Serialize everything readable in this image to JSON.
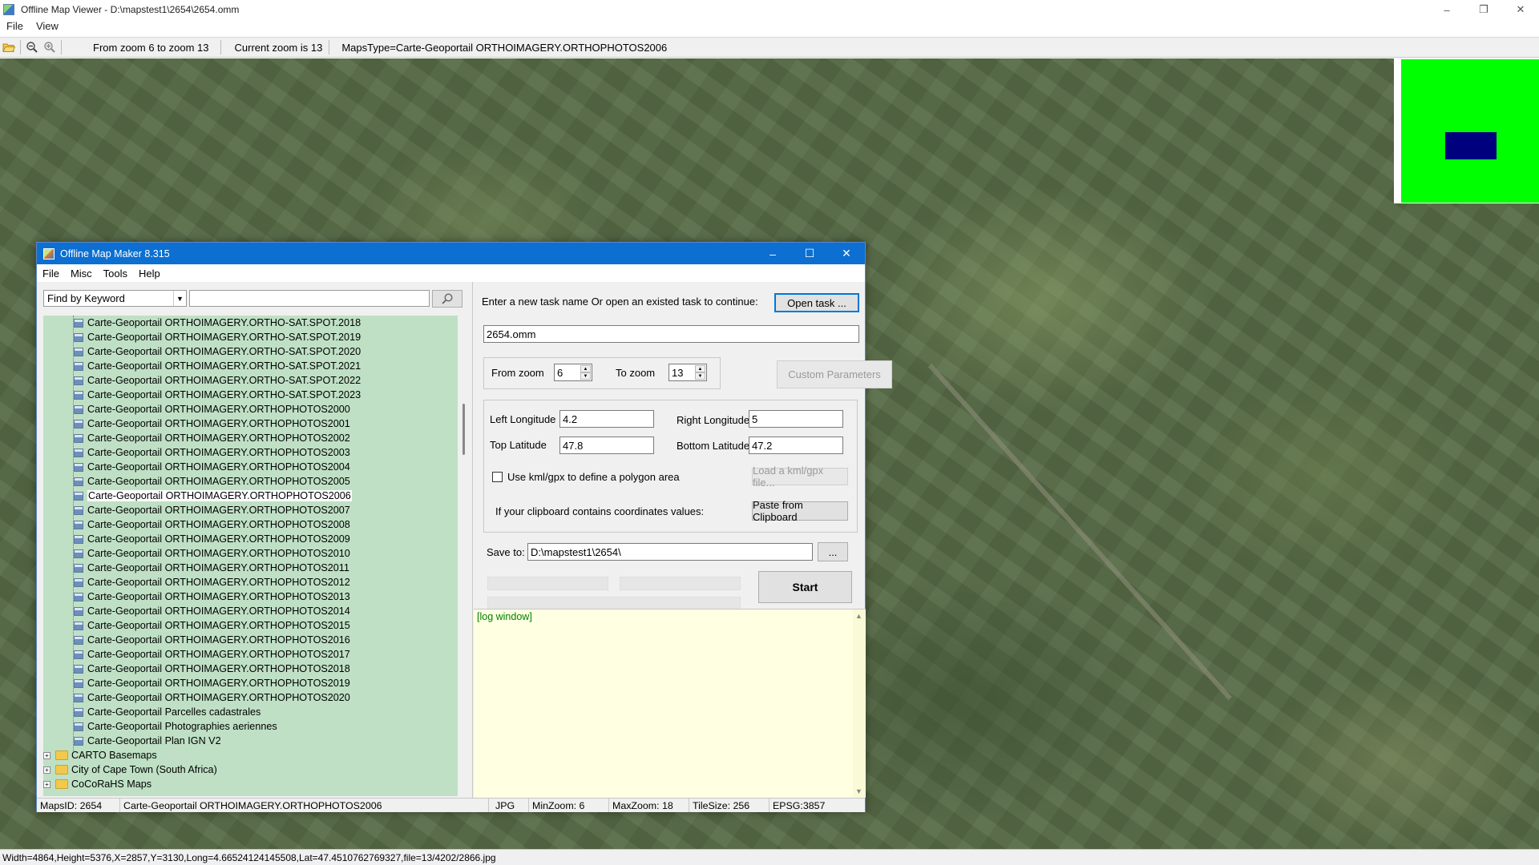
{
  "window": {
    "title": "Offline Map Viewer - D:\\mapstest1\\2654\\2654.omm"
  },
  "menu": [
    "File",
    "View"
  ],
  "toolbar": {
    "zoom_range": "From zoom 6 to zoom 13",
    "current_zoom": "Current zoom is 13",
    "maps_type": "MapsType=Carte-Geoportail ORTHOIMAGERY.ORTHOPHOTOS2006",
    "icons": [
      "folder-open-icon",
      "zoom-out-icon",
      "zoom-in-icon"
    ]
  },
  "overview": {
    "background": "#00ff00",
    "viewport_color": "#00007f"
  },
  "status": "Width=4864,Height=5376,X=2857,Y=3130,Long=4.66524124145508,Lat=47.4510762769327,file=13/4202/2866.jpg",
  "dialog": {
    "title": "Offline Map Maker 8.315",
    "menu": [
      "File",
      "Misc",
      "Tools",
      "Help"
    ],
    "search": {
      "mode": "Find by Keyword",
      "value": "",
      "icon": "search-icon"
    },
    "tree": [
      {
        "label": "Carte-Geoportail ORTHOIMAGERY.ORTHO-SAT.SPOT.2018",
        "type": "leaf"
      },
      {
        "label": "Carte-Geoportail ORTHOIMAGERY.ORTHO-SAT.SPOT.2019",
        "type": "leaf"
      },
      {
        "label": "Carte-Geoportail ORTHOIMAGERY.ORTHO-SAT.SPOT.2020",
        "type": "leaf"
      },
      {
        "label": "Carte-Geoportail ORTHOIMAGERY.ORTHO-SAT.SPOT.2021",
        "type": "leaf"
      },
      {
        "label": "Carte-Geoportail ORTHOIMAGERY.ORTHO-SAT.SPOT.2022",
        "type": "leaf"
      },
      {
        "label": "Carte-Geoportail ORTHOIMAGERY.ORTHO-SAT.SPOT.2023",
        "type": "leaf"
      },
      {
        "label": "Carte-Geoportail ORTHOIMAGERY.ORTHOPHOTOS2000",
        "type": "leaf"
      },
      {
        "label": "Carte-Geoportail ORTHOIMAGERY.ORTHOPHOTOS2001",
        "type": "leaf"
      },
      {
        "label": "Carte-Geoportail ORTHOIMAGERY.ORTHOPHOTOS2002",
        "type": "leaf"
      },
      {
        "label": "Carte-Geoportail ORTHOIMAGERY.ORTHOPHOTOS2003",
        "type": "leaf"
      },
      {
        "label": "Carte-Geoportail ORTHOIMAGERY.ORTHOPHOTOS2004",
        "type": "leaf"
      },
      {
        "label": "Carte-Geoportail ORTHOIMAGERY.ORTHOPHOTOS2005",
        "type": "leaf"
      },
      {
        "label": "Carte-Geoportail ORTHOIMAGERY.ORTHOPHOTOS2006",
        "type": "leaf",
        "selected": true
      },
      {
        "label": "Carte-Geoportail ORTHOIMAGERY.ORTHOPHOTOS2007",
        "type": "leaf"
      },
      {
        "label": "Carte-Geoportail ORTHOIMAGERY.ORTHOPHOTOS2008",
        "type": "leaf"
      },
      {
        "label": "Carte-Geoportail ORTHOIMAGERY.ORTHOPHOTOS2009",
        "type": "leaf"
      },
      {
        "label": "Carte-Geoportail ORTHOIMAGERY.ORTHOPHOTOS2010",
        "type": "leaf"
      },
      {
        "label": "Carte-Geoportail ORTHOIMAGERY.ORTHOPHOTOS2011",
        "type": "leaf"
      },
      {
        "label": "Carte-Geoportail ORTHOIMAGERY.ORTHOPHOTOS2012",
        "type": "leaf"
      },
      {
        "label": "Carte-Geoportail ORTHOIMAGERY.ORTHOPHOTOS2013",
        "type": "leaf"
      },
      {
        "label": "Carte-Geoportail ORTHOIMAGERY.ORTHOPHOTOS2014",
        "type": "leaf"
      },
      {
        "label": "Carte-Geoportail ORTHOIMAGERY.ORTHOPHOTOS2015",
        "type": "leaf"
      },
      {
        "label": "Carte-Geoportail ORTHOIMAGERY.ORTHOPHOTOS2016",
        "type": "leaf"
      },
      {
        "label": "Carte-Geoportail ORTHOIMAGERY.ORTHOPHOTOS2017",
        "type": "leaf"
      },
      {
        "label": "Carte-Geoportail ORTHOIMAGERY.ORTHOPHOTOS2018",
        "type": "leaf"
      },
      {
        "label": "Carte-Geoportail ORTHOIMAGERY.ORTHOPHOTOS2019",
        "type": "leaf"
      },
      {
        "label": "Carte-Geoportail ORTHOIMAGERY.ORTHOPHOTOS2020",
        "type": "leaf"
      },
      {
        "label": "Carte-Geoportail Parcelles cadastrales",
        "type": "leaf"
      },
      {
        "label": "Carte-Geoportail Photographies aeriennes",
        "type": "leaf"
      },
      {
        "label": "Carte-Geoportail Plan IGN V2",
        "type": "leaf"
      },
      {
        "label": "CARTO Basemaps",
        "type": "folder"
      },
      {
        "label": "City of Cape Town (South Africa)",
        "type": "folder"
      },
      {
        "label": "CoCoRaHS Maps",
        "type": "folder"
      }
    ],
    "task": {
      "prompt": "Enter a new task name Or open an existed task to continue:",
      "open_button": "Open task ...",
      "name": "2654.omm"
    },
    "zoom": {
      "from_label": "From zoom",
      "from_value": "6",
      "to_label": "To zoom",
      "to_value": "13",
      "custom_button": "Custom Parameters"
    },
    "coords": {
      "left_label": "Left Longitude",
      "left_value": "4.2",
      "right_label": "Right Longitude",
      "right_value": "5",
      "top_label": "Top Latitude",
      "top_value": "47.8",
      "bottom_label": "Bottom Latitude",
      "bottom_value": "47.2",
      "kml_checkbox_label": "Use kml/gpx to define a polygon area",
      "kml_button": "Load a kml/gpx file...",
      "clipboard_label": "If your clipboard contains coordinates values:",
      "clipboard_button": "Paste from Clipboard"
    },
    "save": {
      "label": "Save to:",
      "value": "D:\\mapstest1\\2654\\",
      "browse_button": "..."
    },
    "start_button": "Start",
    "log": "[log window]",
    "status": {
      "maps_id": "MapsID: 2654",
      "map_name": "Carte-Geoportail ORTHOIMAGERY.ORTHOPHOTOS2006",
      "format": "JPG",
      "min_zoom": "MinZoom: 6",
      "max_zoom": "MaxZoom: 18",
      "tile_size": "TileSize: 256",
      "epsg": "EPSG:3857"
    }
  }
}
